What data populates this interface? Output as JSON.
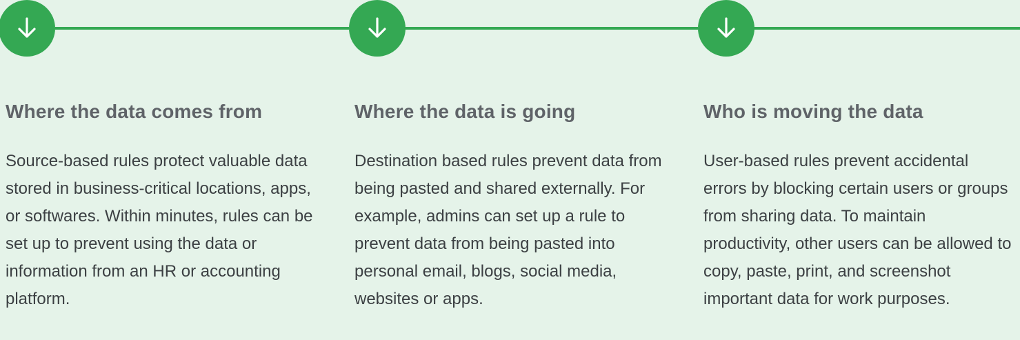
{
  "colors": {
    "background": "#e5f3e9",
    "accent": "#34a853",
    "heading": "#5f6368",
    "body_text": "#3c4043"
  },
  "columns": [
    {
      "icon": "arrow-down-icon",
      "heading": "Where the data comes from",
      "description": "Source-based rules protect valuable data stored in business-critical locations, apps, or softwares. Within minutes, rules can be set up to prevent using the data or information from an HR or accounting platform."
    },
    {
      "icon": "arrow-down-icon",
      "heading": "Where the data is going",
      "description": "Destination based rules prevent data from being pasted and shared externally. For example, admins can set up a rule to prevent data from being pasted into personal email, blogs, social media, websites or apps."
    },
    {
      "icon": "arrow-down-icon",
      "heading": "Who is moving the data",
      "description": "User-based rules prevent accidental errors by blocking certain users or groups from sharing data. To maintain productivity, other users can be allowed to copy, paste, print, and screenshot important data for work purposes."
    }
  ]
}
